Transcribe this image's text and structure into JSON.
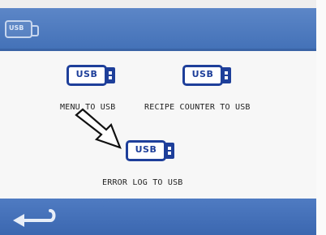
{
  "header": {
    "icon": "usb-icon",
    "icon_label": "USB"
  },
  "actions": [
    {
      "id": "menu",
      "usb_label": "USB",
      "caption": "MENU TO USB"
    },
    {
      "id": "recipe",
      "usb_label": "USB",
      "caption": "RECIPE COUNTER TO USB"
    },
    {
      "id": "error",
      "usb_label": "USB",
      "caption": "ERROR LOG TO USB"
    }
  ],
  "footer": {
    "back_icon": "return-arrow-icon"
  },
  "colors": {
    "header": "#4a77bd",
    "footer": "#3f6bb3",
    "usb_blue": "#1e3f9a",
    "background": "#f7f7f7"
  }
}
